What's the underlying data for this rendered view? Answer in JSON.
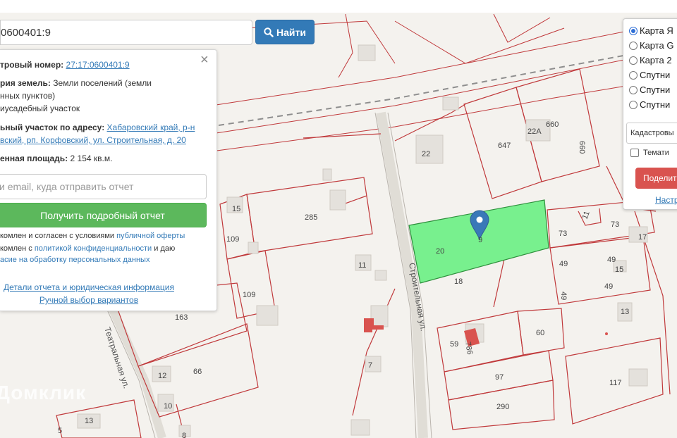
{
  "search": {
    "value": "0600401:9",
    "button_label": "Найти"
  },
  "info": {
    "cadastral_label": "тровый номер:",
    "cadastral_value": "27:17:0600401:9",
    "category_label": "рия земель:",
    "category_value": "Земли поселений (земли",
    "category_cont": "нных пунктов)",
    "usage_value": "иусадебный участок",
    "address_label": "ьный участок по адресу:",
    "address_line1": "Хабаровский край, р-н",
    "address_line2": "вский, рп. Корфовский, ул. Строительная, д. 20",
    "area_label": "енная площадь:",
    "area_value": "2 154 кв.м.",
    "email_placeholder": "и email, куда отправить отчет",
    "report_button": "Получить подробный отчет",
    "consent1_a": "комлен и согласен с условиями ",
    "consent1_b": "публичной оферты",
    "consent2_a": "комлен с ",
    "consent2_b": "политикой конфиденциальности",
    "consent2_c": " и даю",
    "consent3": "асие на обработку персональных данных",
    "details_link": "Детали отчета и юридическая информация",
    "manual_link": "Ручной выбор вариантов"
  },
  "layers": {
    "options": [
      "Карта Я",
      "Карта G",
      "Карта 2",
      "Спутни",
      "Спутни",
      "Спутни"
    ],
    "selected_index": 0,
    "cadastral_select": "Кадастровы",
    "thematic_label": "Темати",
    "share_button": "Поделит",
    "settings_link": "Настр"
  },
  "map": {
    "street_labels": [
      "Строительная ул.",
      "Театральная ул."
    ],
    "parcel_labels": [
      "22",
      "22А",
      "647",
      "660",
      "660",
      "15",
      "285",
      "109",
      "109",
      "11",
      "20",
      "9",
      "18",
      "73",
      "73",
      "11",
      "17",
      "49",
      "49",
      "49",
      "49",
      "15",
      "163",
      "13",
      "59",
      "786",
      "60",
      "12",
      "66",
      "7",
      "97",
      "117",
      "10",
      "290",
      "13",
      "5",
      "8"
    ],
    "watermark": "Домклик",
    "colors": {
      "parcel_border": "#c0393b",
      "selected_fill": "#78f08e",
      "marker": "#3a78b8"
    }
  }
}
